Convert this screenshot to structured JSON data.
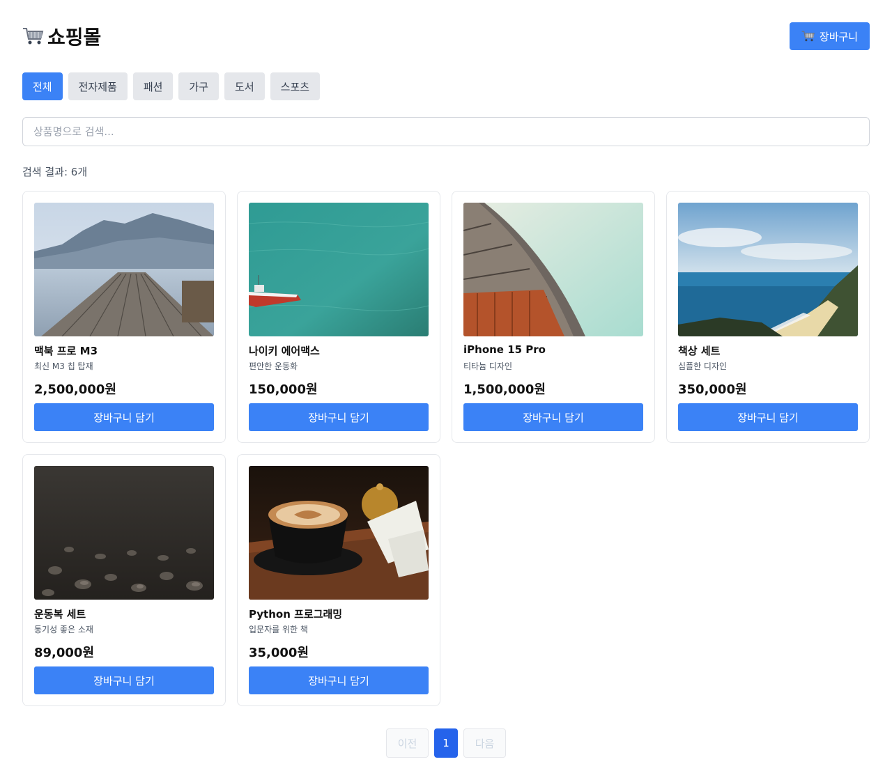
{
  "header": {
    "title": "쇼핑몰",
    "cart_label": "장바구니",
    "cart_icon": "shopping-cart-icon"
  },
  "categories": [
    "전체",
    "전자제품",
    "패션",
    "가구",
    "도서",
    "스포츠"
  ],
  "active_category": "전체",
  "search": {
    "placeholder": "상품명으로 검색...",
    "value": ""
  },
  "result_count": "검색 결과: 6개",
  "products": [
    {
      "name": "맥북 프로 M3",
      "desc": "최신 M3 칩 탑재",
      "price": "2,500,000원",
      "button": "장바구니 담기",
      "image": "mountain-lake-pier"
    },
    {
      "name": "나이키 에어맥스",
      "desc": "편안한 운동화",
      "price": "150,000원",
      "button": "장바구니 담기",
      "image": "boat-on-green-water"
    },
    {
      "name": "iPhone 15 Pro",
      "desc": "티타늄 디자인",
      "price": "1,500,000원",
      "button": "장바구니 담기",
      "image": "curved-building-roof"
    },
    {
      "name": "책상 세트",
      "desc": "심플한 디자인",
      "price": "350,000원",
      "button": "장바구니 담기",
      "image": "coastline-beach"
    },
    {
      "name": "운동복 세트",
      "desc": "통기성 좋은 소재",
      "price": "89,000원",
      "button": "장바구니 담기",
      "image": "dark-pebbles"
    },
    {
      "name": "Python 프로그래밍",
      "desc": "입문자를 위한 책",
      "price": "35,000원",
      "button": "장바구니 담기",
      "image": "coffee-cup-bell"
    }
  ],
  "pagination": {
    "prev": "이전",
    "current": "1",
    "next": "다음"
  },
  "colors": {
    "primary": "#3b82f6",
    "primary_dark": "#2563eb",
    "tab_bg": "#e5e7eb"
  }
}
